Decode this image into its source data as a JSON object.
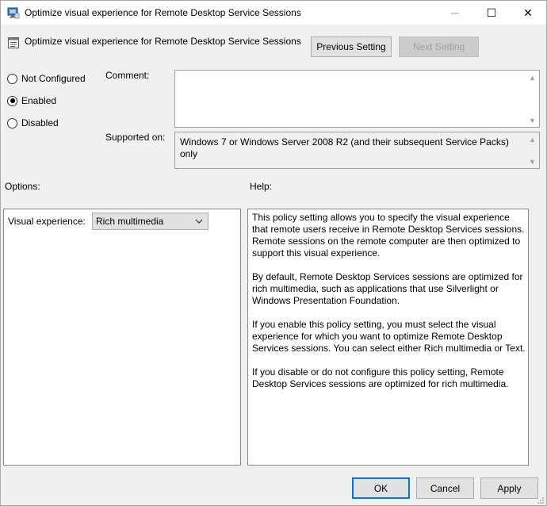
{
  "window": {
    "title": "Optimize visual experience for Remote Desktop Service Sessions",
    "controls": {
      "minimize": "─",
      "maximize": "☐",
      "close": "✕"
    }
  },
  "header": {
    "title": "Optimize visual experience for Remote Desktop Service Sessions",
    "previous_label": "Previous Setting",
    "next_label": "Next Setting"
  },
  "state": {
    "options": [
      {
        "label": "Not Configured",
        "checked": false
      },
      {
        "label": "Enabled",
        "checked": true
      },
      {
        "label": "Disabled",
        "checked": false
      }
    ]
  },
  "comment": {
    "label": "Comment:",
    "value": ""
  },
  "supported": {
    "label": "Supported on:",
    "value": "Windows 7 or Windows Server 2008 R2 (and their subsequent Service Packs) only"
  },
  "options_section": {
    "label": "Options:",
    "visual_label": "Visual experience:",
    "visual_value": "Rich multimedia"
  },
  "help_section": {
    "label": "Help:",
    "paragraphs": [
      "This policy setting allows you to specify the visual experience that remote users receive in Remote Desktop Services sessions. Remote sessions on the remote computer are then optimized to support this visual experience.",
      "By default, Remote Desktop Services sessions are optimized for rich multimedia, such as applications that use Silverlight or Windows Presentation Foundation.",
      "If you enable this policy setting, you must select the visual experience for which you want to optimize Remote Desktop Services sessions. You can select either Rich multimedia or Text.",
      "If you disable or do not configure this policy setting, Remote Desktop Services sessions are optimized for rich multimedia."
    ]
  },
  "footer": {
    "ok": "OK",
    "cancel": "Cancel",
    "apply": "Apply"
  },
  "colors": {
    "focus_accent": "#0078d7",
    "window_bg": "#f0f0f0"
  }
}
